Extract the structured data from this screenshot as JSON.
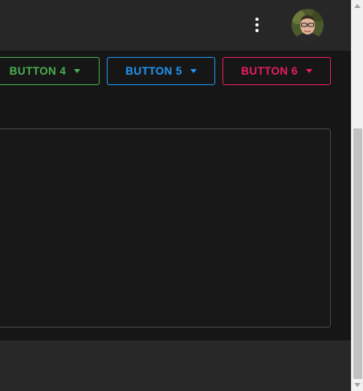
{
  "header": {
    "more_icon": "more-vert-icon",
    "avatar_icon": "user-avatar"
  },
  "toolbar": {
    "buttons": [
      {
        "label": "BUTTON 4",
        "color": "#4caf50",
        "icon": "arrow-drop-down-icon"
      },
      {
        "label": "BUTTON 5",
        "color": "#2196f3",
        "icon": "arrow-drop-down-icon"
      },
      {
        "label": "BUTTON 6",
        "color": "#e91e63",
        "icon": "arrow-drop-down-icon"
      }
    ]
  },
  "theme": {
    "background": "#161616",
    "app_bar": "#272727",
    "panel_border": "#4a4a4a"
  }
}
